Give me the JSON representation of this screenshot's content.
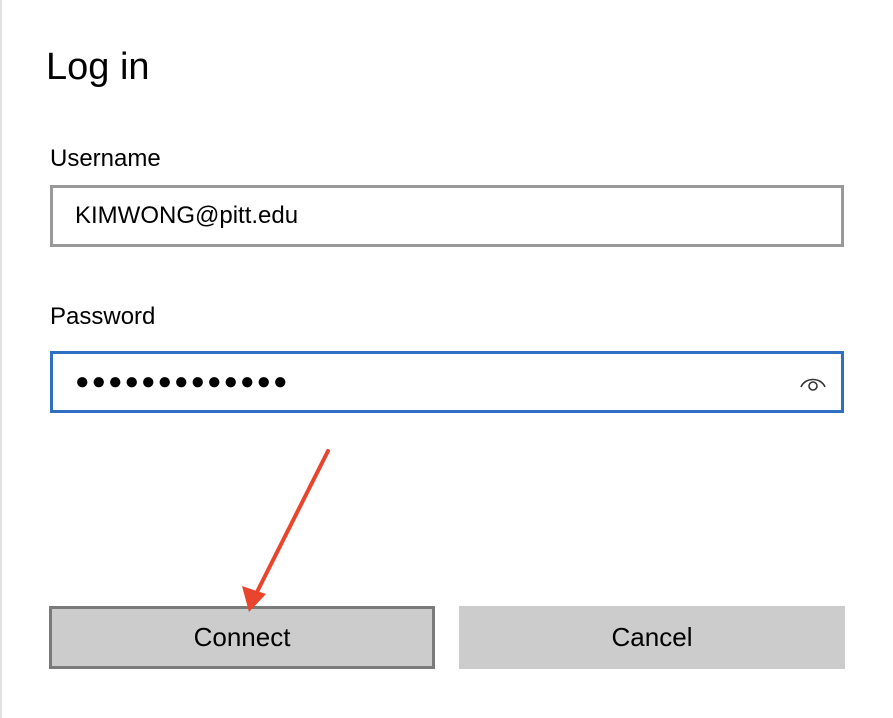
{
  "dialog": {
    "title": "Log in",
    "username": {
      "label": "Username",
      "value": "KIMWONG@pitt.edu"
    },
    "password": {
      "label": "Password",
      "masked_value": "●●●●●●●●●●●●●",
      "reveal_icon": "eye-icon"
    },
    "buttons": {
      "connect_label": "Connect",
      "cancel_label": "Cancel"
    }
  },
  "annotation": {
    "type": "arrow",
    "points_to": "connect-button",
    "color": "#e8452c"
  },
  "colors": {
    "focus_border": "#2f6fc2",
    "field_border": "#999999",
    "button_bg": "#cccccc",
    "default_button_border": "#7a7a7a"
  }
}
